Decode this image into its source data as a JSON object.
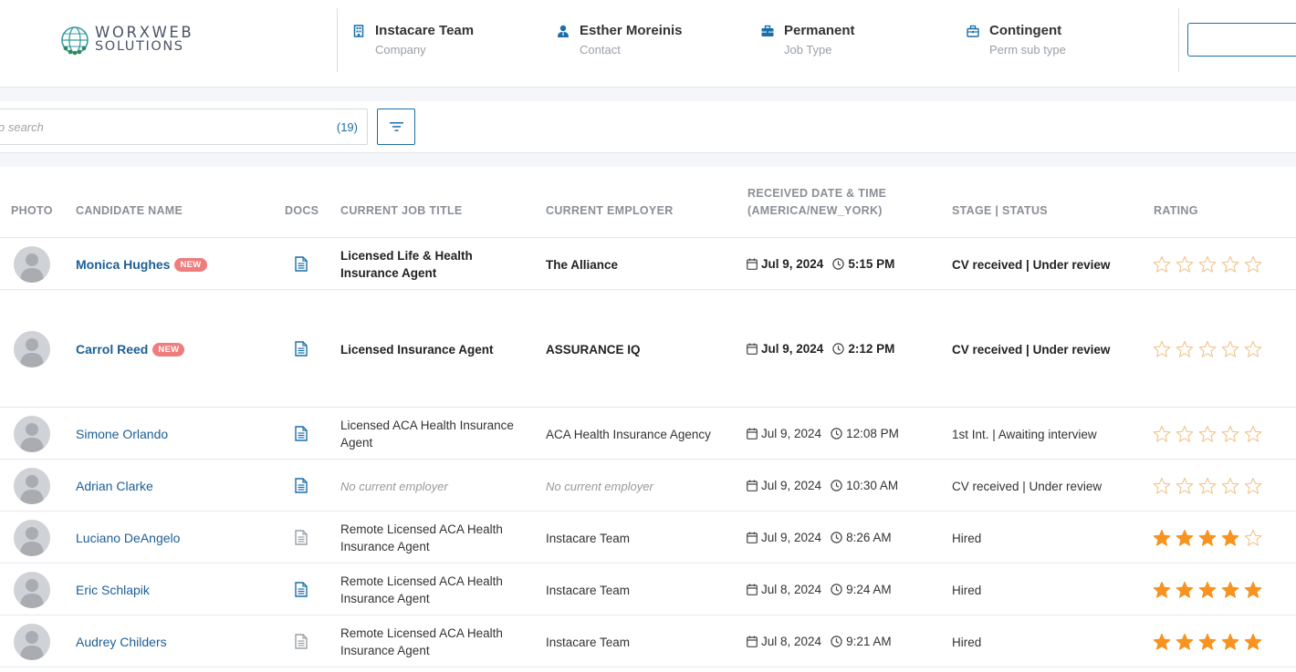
{
  "header": {
    "logo": {
      "line1": "WORXWEB",
      "line2": "SOLUTIONS"
    },
    "items": [
      {
        "value": "Instacare Team",
        "label": "Company",
        "icon": "building-icon"
      },
      {
        "value": "Esther Moreinis",
        "label": "Contact",
        "icon": "user-icon"
      },
      {
        "value": "Permanent",
        "label": "Job Type",
        "icon": "briefcase-icon"
      },
      {
        "value": "Contingent",
        "label": "Perm sub type",
        "icon": "briefcase-outline-icon"
      }
    ]
  },
  "toolbar": {
    "search_placeholder": "o search",
    "count": "(19)"
  },
  "table": {
    "headers": {
      "photo": "PHOTO",
      "name": "CANDIDATE NAME",
      "docs": "DOCS",
      "title": "CURRENT JOB TITLE",
      "employer": "CURRENT EMPLOYER",
      "received_1": "RECEIVED DATE & TIME",
      "received_2": "(AMERICA/NEW_YORK)",
      "stage": "STAGE | STATUS",
      "rating": "RATING"
    },
    "new_label": "NEW",
    "rows": [
      {
        "name": "Monica Hughes",
        "is_new": true,
        "doc_active": true,
        "title": "Licensed Life & Health Insurance Agent",
        "employer": "The Alliance",
        "date": "Jul 9, 2024",
        "time": "5:15 PM",
        "stage": "CV received | Under review",
        "rating": 0
      },
      {
        "name": "Carrol Reed",
        "is_new": true,
        "doc_active": true,
        "title": "Licensed Insurance Agent",
        "employer": "ASSURANCE IQ",
        "date": "Jul 9, 2024",
        "time": "2:12 PM",
        "stage": "CV received | Under review",
        "rating": 0
      },
      {
        "name": "Simone Orlando",
        "is_new": false,
        "doc_active": true,
        "title": "Licensed ACA Health Insurance Agent",
        "employer": "ACA Health Insurance Agency",
        "date": "Jul 9, 2024",
        "time": "12:08 PM",
        "stage": "1st Int. | Awaiting interview",
        "rating": 0
      },
      {
        "name": "Adrian Clarke",
        "is_new": false,
        "doc_active": true,
        "title": "No current employer",
        "employer": "No current employer",
        "placeholder": true,
        "date": "Jul 9, 2024",
        "time": "10:30 AM",
        "stage": "CV received | Under review",
        "rating": 0
      },
      {
        "name": "Luciano DeAngelo",
        "is_new": false,
        "doc_active": false,
        "title": "Remote Licensed ACA Health Insurance Agent",
        "employer": "Instacare Team",
        "date": "Jul 9, 2024",
        "time": "8:26 AM",
        "stage": "Hired",
        "rating": 4
      },
      {
        "name": "Eric Schlapik",
        "is_new": false,
        "doc_active": true,
        "title": "Remote Licensed ACA Health Insurance Agent",
        "employer": "Instacare Team",
        "date": "Jul 8, 2024",
        "time": "9:24 AM",
        "stage": "Hired",
        "rating": 5
      },
      {
        "name": "Audrey Childers",
        "is_new": false,
        "doc_active": false,
        "title": "Remote Licensed ACA Health Insurance Agent",
        "employer": "Instacare Team",
        "date": "Jul 8, 2024",
        "time": "9:21 AM",
        "stage": "Hired",
        "rating": 5
      }
    ]
  },
  "colors": {
    "link": "#1c5f95",
    "accent": "#1a6fa8",
    "badge": "#f07d7d",
    "star_filled": "#f7931e",
    "star_empty": "#f2c48d"
  }
}
